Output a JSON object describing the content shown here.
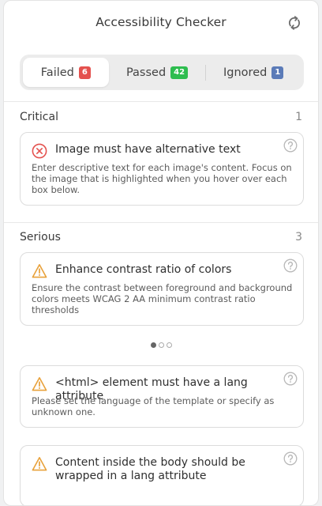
{
  "header": {
    "title": "Accessibility Checker",
    "refresh_icon": "refresh-icon"
  },
  "tabs": [
    {
      "label": "Failed",
      "count": "6",
      "badge_color": "#e4514e"
    },
    {
      "label": "Passed",
      "count": "42",
      "badge_color": "#2ebd4f"
    },
    {
      "label": "Ignored",
      "count": "1",
      "badge_color": "#5b7bb8"
    }
  ],
  "sections": [
    {
      "title": "Critical",
      "count": "1",
      "issues": [
        {
          "title": "Image must have alternative text",
          "description": "Enter descriptive text for each image's content. Focus on the image that is highlighted when you hover over each box below.",
          "icon": "error-circle-icon"
        }
      ]
    },
    {
      "title": "Serious",
      "count": "3",
      "issues": [
        {
          "title": "Enhance contrast ratio of colors",
          "description": "Ensure the contrast between foreground and background colors meets WCAG 2 AA minimum contrast ratio thresholds",
          "icon": "warning-icon"
        },
        {
          "title": "<html> element must have a lang attribute",
          "description": "Please set the language of the template or specify as unknown one.",
          "icon": "warning-icon"
        },
        {
          "title": "Content inside the body should be wrapped in a lang attribute",
          "description": "",
          "icon": "warning-icon"
        }
      ]
    }
  ],
  "pager": {
    "pages": 3,
    "active": 1
  },
  "colors": {
    "critical": "#e4514e",
    "serious": "#e8a13a",
    "help": "#b8b8b8"
  }
}
